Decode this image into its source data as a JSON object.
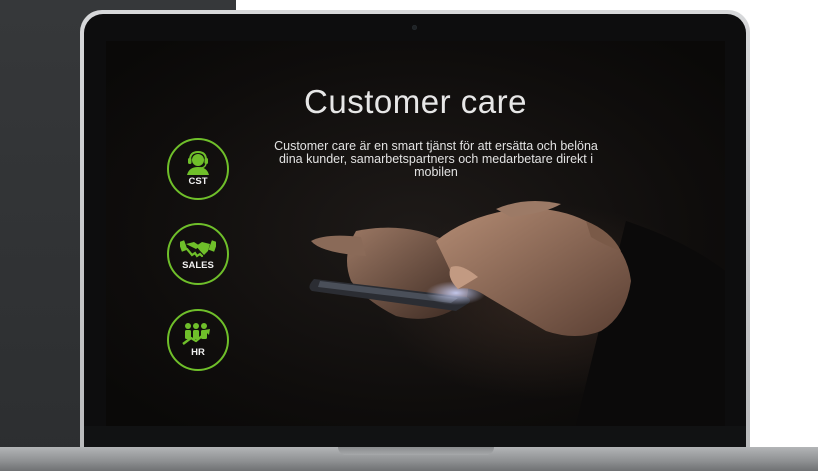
{
  "slide": {
    "title": "Customer care",
    "description": "Customer care är en smart tjänst för att ersätta och belöna dina kunder, samarbetspartners och medarbetare direkt i mobilen"
  },
  "badges": [
    {
      "label": "CST",
      "icon": "headset-agent-icon"
    },
    {
      "label": "SALES",
      "icon": "handshake-icon"
    },
    {
      "label": "HR",
      "icon": "team-growth-icon"
    }
  ],
  "colors": {
    "accent": "#6fbf2a",
    "screen_background": "#0f0d0c",
    "text": "#e7e7e7"
  }
}
